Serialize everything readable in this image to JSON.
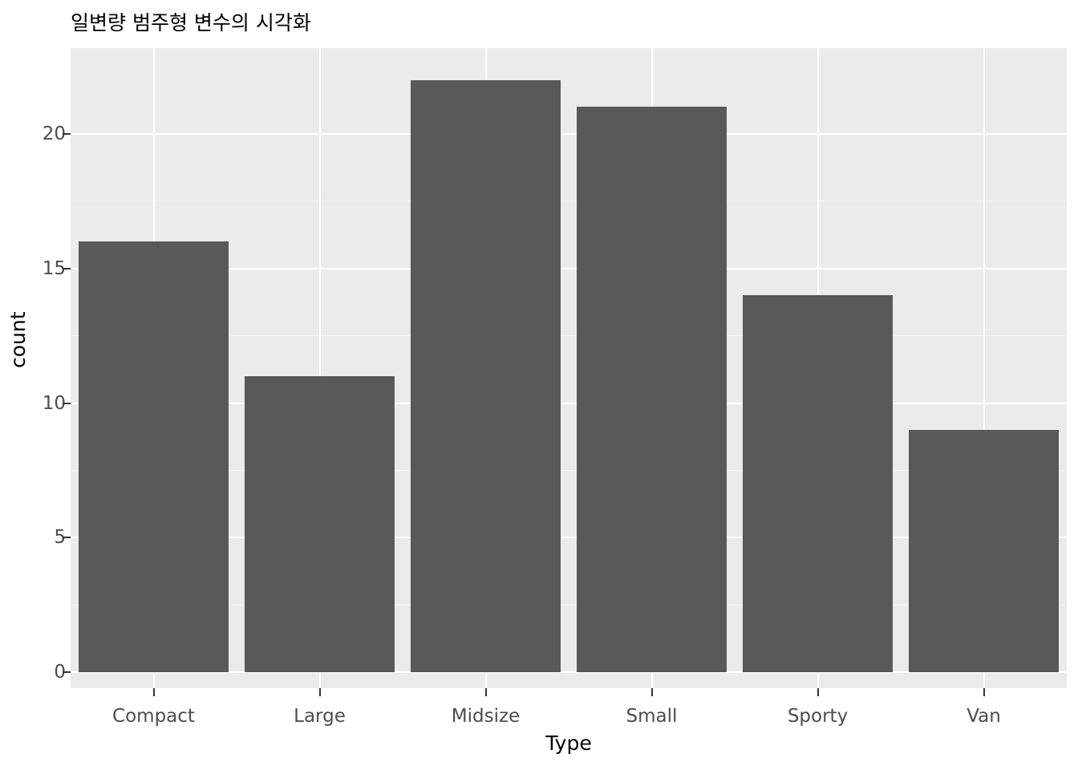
{
  "chart_data": {
    "type": "bar",
    "title": "일변량 범주형 변수의 시각화",
    "xlabel": "Type",
    "ylabel": "count",
    "categories": [
      "Compact",
      "Large",
      "Midsize",
      "Small",
      "Sporty",
      "Van"
    ],
    "values": [
      16,
      11,
      22,
      21,
      14,
      9
    ],
    "ylim": [
      0,
      22.6
    ],
    "ytick_values": [
      0,
      5,
      10,
      15,
      20
    ],
    "ytick_labels": [
      "0",
      "5",
      "10",
      "15",
      "20"
    ],
    "yminor_values": [
      2.5,
      7.5,
      12.5,
      17.5
    ],
    "grid": true,
    "legend": "none",
    "colors": {
      "bar_fill": "#595959",
      "panel_background": "#EBEBEB",
      "grid_major": "#FFFFFF",
      "grid_minor": "#F5F5F5",
      "page_background": "#FFFFFF",
      "tick_label": "#4D4D4D",
      "axis_title": "#000000"
    }
  }
}
